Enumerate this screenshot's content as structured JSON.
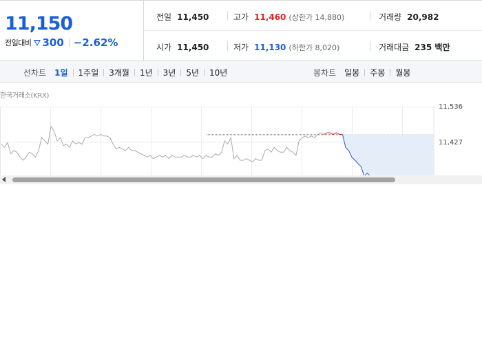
{
  "quote": {
    "price": "11,150",
    "change_label": "전일대비",
    "change_amount": "300",
    "change_percent": "−2.62%",
    "stats": {
      "prev_close": {
        "label": "전일",
        "value": "11,450"
      },
      "high": {
        "label": "고가",
        "value": "11,460",
        "sub": "(상한가 14,880)"
      },
      "volume": {
        "label": "거래량",
        "value": "20,982"
      },
      "open": {
        "label": "시가",
        "value": "11,450"
      },
      "low": {
        "label": "저가",
        "value": "11,130",
        "sub": "(하한가 8,020)"
      },
      "amount": {
        "label": "거래대금",
        "value": "235 백만"
      }
    }
  },
  "tabs": {
    "line_label": "선차트",
    "line_tabs": [
      "1일",
      "1주일",
      "3개월",
      "1년",
      "3년",
      "5년",
      "10년"
    ],
    "line_active_index": 0,
    "candle_label": "봉차트",
    "candle_tabs": [
      "일봉",
      "주봉",
      "월봉"
    ]
  },
  "chart": {
    "source": "한국거래소(KRX)",
    "y_ticks": [
      "11,536",
      "11,427"
    ],
    "colors": {
      "up": "#e0201d",
      "down": "#1a5fd8",
      "flat": "#aaaaaa",
      "fill": "#e5edf9"
    }
  },
  "chart_data": {
    "type": "line",
    "ylim": [
      11318,
      11536
    ],
    "yticks": [
      11536,
      11427
    ],
    "reference_value": 11450,
    "series": [
      {
        "values": [
          11420,
          11410,
          11425,
          11390,
          11400,
          11395,
          11380,
          11370,
          11380,
          11395,
          11390,
          11380,
          11400,
          11440,
          11430,
          11420,
          11475,
          11460,
          11430,
          11440,
          11415,
          11420,
          11410,
          11430,
          11420,
          11425,
          11420,
          11440,
          11440,
          11445,
          11450,
          11445,
          11450,
          11445,
          11445,
          11440,
          11420,
          11405,
          11410,
          11405,
          11400,
          11410,
          11400,
          11400,
          11395,
          11390,
          11385,
          11380,
          11385,
          11375,
          11380,
          11385,
          11380,
          11385,
          11375,
          11385,
          11380,
          11380,
          11380,
          11385,
          11380,
          11380,
          11385,
          11380,
          11385,
          11375,
          11385,
          11380,
          11380,
          11390,
          11385,
          11395,
          11430,
          11420,
          11440,
          11375,
          11385,
          11370,
          11370,
          11375,
          11370,
          11365,
          11375,
          11370,
          11370,
          11400,
          11405,
          11395,
          11410,
          11400,
          11395,
          11395,
          11410,
          11400,
          11395,
          11385,
          11430,
          11440,
          11445,
          11440,
          11445,
          11440,
          11450,
          11455,
          11450,
          11455,
          11455,
          11450,
          11455,
          11450,
          11450,
          11410,
          11400,
          11380,
          11370,
          11360,
          11350,
          11320,
          11330,
          11320,
          11310,
          11300,
          11300,
          11290,
          11290,
          11300,
          11290,
          11290,
          11290,
          11285,
          11280,
          11290,
          11285,
          11290,
          11285,
          11290,
          11285,
          11290,
          11285,
          11290
        ]
      }
    ]
  },
  "scrollbar": {
    "position": 0.0
  }
}
